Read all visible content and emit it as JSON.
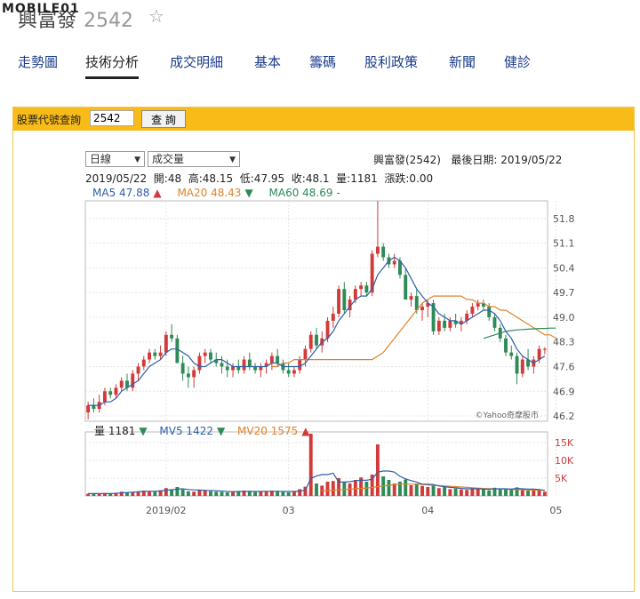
{
  "watermark": "MOBILE01",
  "header": {
    "name": "興富發",
    "code": "2542"
  },
  "tabs": [
    {
      "label": "走勢圖"
    },
    {
      "label": "技術分析"
    },
    {
      "label": "成交明細"
    },
    {
      "label": "基本"
    },
    {
      "label": "籌碼"
    },
    {
      "label": "股利政策"
    },
    {
      "label": "新聞"
    },
    {
      "label": "健診"
    }
  ],
  "query": {
    "label": "股票代號查詢",
    "value": "2542",
    "button": "查 詢"
  },
  "controls": {
    "period": "日線",
    "indicator": "成交量"
  },
  "info": {
    "title": "興富發(2542)",
    "date_label": "最後日期:",
    "date": "2019/05/22"
  },
  "quote": {
    "text": "2019/05/22  開:48  高:48.15  低:47.95  收:48.1  量:1181  漲跌:0.00"
  },
  "ma": [
    {
      "label": "MA5 47.88",
      "arrow": "▲",
      "color": "#2f5fa8",
      "arrow_color": "#d23a3a"
    },
    {
      "label": "MA20 48.43",
      "arrow": "▼",
      "color": "#e0832a",
      "arrow_color": "#2e8b57"
    },
    {
      "label": "MA60 48.69",
      "arrow": "-",
      "color": "#2e8b57",
      "arrow_color": "#2e8b57"
    }
  ],
  "vol_legend": [
    {
      "label": "量 1181",
      "arrow": "▼",
      "color": "#222",
      "arrow_color": "#2e8b57"
    },
    {
      "label": "MV5 1422",
      "arrow": "▼",
      "color": "#2f5fa8",
      "arrow_color": "#2e8b57"
    },
    {
      "label": "MV20 1575",
      "arrow": "▲",
      "color": "#e0832a",
      "arrow_color": "#d23a3a"
    }
  ],
  "copyright": "©Yahoo奇摩股市",
  "chart_data": [
    {
      "type": "candlestick",
      "y_ticks": [
        46.2,
        46.9,
        47.6,
        48.3,
        49.0,
        49.7,
        50.4,
        51.1,
        51.8
      ],
      "ylim": [
        46.05,
        52.3
      ],
      "x_ticks": [
        "2019/02",
        "03",
        "04",
        "05"
      ],
      "x_tick_index": [
        14,
        36,
        61,
        84
      ],
      "up_color": "#d23a3a",
      "down_color": "#2e8b57",
      "ohlc": [
        [
          46.3,
          46.6,
          46.1,
          46.5
        ],
        [
          46.5,
          46.7,
          46.3,
          46.4
        ],
        [
          46.4,
          46.8,
          46.3,
          46.6
        ],
        [
          46.6,
          47.0,
          46.5,
          46.9
        ],
        [
          46.9,
          47.0,
          46.7,
          46.8
        ],
        [
          46.8,
          47.1,
          46.7,
          47.0
        ],
        [
          47.0,
          47.3,
          46.9,
          47.2
        ],
        [
          47.2,
          47.4,
          46.9,
          47.0
        ],
        [
          47.0,
          47.5,
          46.9,
          47.4
        ],
        [
          47.4,
          47.7,
          47.2,
          47.6
        ],
        [
          47.6,
          47.9,
          47.5,
          47.8
        ],
        [
          47.8,
          48.1,
          47.7,
          48.0
        ],
        [
          48.0,
          48.1,
          47.8,
          47.9
        ],
        [
          47.9,
          48.2,
          47.8,
          48.0
        ],
        [
          48.0,
          48.6,
          47.9,
          48.5
        ],
        [
          48.5,
          48.8,
          48.3,
          48.4
        ],
        [
          48.4,
          48.5,
          47.8,
          47.7
        ],
        [
          47.7,
          47.9,
          47.2,
          47.4
        ],
        [
          47.4,
          47.6,
          47.0,
          47.3
        ],
        [
          47.3,
          47.6,
          47.0,
          47.5
        ],
        [
          47.5,
          48.0,
          47.4,
          47.9
        ],
        [
          47.9,
          48.1,
          47.7,
          48.0
        ],
        [
          48.0,
          48.1,
          47.7,
          47.8
        ],
        [
          47.8,
          48.0,
          47.6,
          47.7
        ],
        [
          47.7,
          47.9,
          47.4,
          47.6
        ],
        [
          47.6,
          47.8,
          47.3,
          47.5
        ],
        [
          47.5,
          47.7,
          47.3,
          47.6
        ],
        [
          47.6,
          47.8,
          47.4,
          47.5
        ],
        [
          47.5,
          47.9,
          47.4,
          47.8
        ],
        [
          47.8,
          48.0,
          47.5,
          47.6
        ],
        [
          47.6,
          47.7,
          47.4,
          47.5
        ],
        [
          47.5,
          47.7,
          47.3,
          47.6
        ],
        [
          47.6,
          47.8,
          47.4,
          47.7
        ],
        [
          47.7,
          48.0,
          47.5,
          47.9
        ],
        [
          47.9,
          48.1,
          47.6,
          47.7
        ],
        [
          47.7,
          47.8,
          47.4,
          47.5
        ],
        [
          47.5,
          47.7,
          47.3,
          47.4
        ],
        [
          47.4,
          47.6,
          47.3,
          47.5
        ],
        [
          47.5,
          47.9,
          47.4,
          47.8
        ],
        [
          47.8,
          48.2,
          47.6,
          48.1
        ],
        [
          48.1,
          48.6,
          48.0,
          48.5
        ],
        [
          48.5,
          48.7,
          48.1,
          48.2
        ],
        [
          48.2,
          48.6,
          48.0,
          48.4
        ],
        [
          48.4,
          49.0,
          48.3,
          48.9
        ],
        [
          48.9,
          49.3,
          48.7,
          49.1
        ],
        [
          49.1,
          49.9,
          49.0,
          49.8
        ],
        [
          49.8,
          50.0,
          49.1,
          49.2
        ],
        [
          49.2,
          49.6,
          49.0,
          49.5
        ],
        [
          49.5,
          49.9,
          49.4,
          49.8
        ],
        [
          49.8,
          50.0,
          49.6,
          49.9
        ],
        [
          49.9,
          50.0,
          49.6,
          49.7
        ],
        [
          49.7,
          50.9,
          49.6,
          50.8
        ],
        [
          50.8,
          52.3,
          50.7,
          51.0
        ],
        [
          51.0,
          51.1,
          50.6,
          50.7
        ],
        [
          50.7,
          50.8,
          50.4,
          50.5
        ],
        [
          50.5,
          50.8,
          50.4,
          50.6
        ],
        [
          50.6,
          50.7,
          50.1,
          50.2
        ],
        [
          50.2,
          50.4,
          49.8,
          49.5
        ],
        [
          49.5,
          49.7,
          49.3,
          49.6
        ],
        [
          49.6,
          49.8,
          49.1,
          49.2
        ],
        [
          49.2,
          49.4,
          48.9,
          49.3
        ],
        [
          49.3,
          49.5,
          49.0,
          49.4
        ],
        [
          49.4,
          49.5,
          48.5,
          48.6
        ],
        [
          48.6,
          49.0,
          48.5,
          48.9
        ],
        [
          48.9,
          49.1,
          48.6,
          48.7
        ],
        [
          48.7,
          49.0,
          48.6,
          48.9
        ],
        [
          48.9,
          49.1,
          48.7,
          48.8
        ],
        [
          48.8,
          49.0,
          48.6,
          48.9
        ],
        [
          48.9,
          49.2,
          48.8,
          49.1
        ],
        [
          49.1,
          49.4,
          49.0,
          49.3
        ],
        [
          49.3,
          49.5,
          49.2,
          49.4
        ],
        [
          49.4,
          49.5,
          49.2,
          49.3
        ],
        [
          49.3,
          49.4,
          48.9,
          49.0
        ],
        [
          49.0,
          49.1,
          48.6,
          48.7
        ],
        [
          48.7,
          48.8,
          48.3,
          48.4
        ],
        [
          48.4,
          48.5,
          47.9,
          48.0
        ],
        [
          48.0,
          48.2,
          47.8,
          47.9
        ],
        [
          47.9,
          48.0,
          47.1,
          47.4
        ],
        [
          47.4,
          47.9,
          47.3,
          47.8
        ],
        [
          47.8,
          48.1,
          47.5,
          47.6
        ],
        [
          47.6,
          47.9,
          47.4,
          47.8
        ],
        [
          47.8,
          48.2,
          47.7,
          48.1
        ],
        [
          48.1,
          48.15,
          47.95,
          48.1
        ]
      ],
      "ma5": [
        46.5,
        46.5,
        46.5,
        46.6,
        46.6,
        46.7,
        46.9,
        47.0,
        47.1,
        47.2,
        47.4,
        47.6,
        47.7,
        47.8,
        48.0,
        48.1,
        48.1,
        48.0,
        47.9,
        47.7,
        47.6,
        47.6,
        47.7,
        47.8,
        47.8,
        47.7,
        47.6,
        47.6,
        47.6,
        47.6,
        47.6,
        47.6,
        47.6,
        47.7,
        47.7,
        47.6,
        47.6,
        47.6,
        47.6,
        47.7,
        47.9,
        48.1,
        48.3,
        48.4,
        48.6,
        48.9,
        49.1,
        49.3,
        49.5,
        49.6,
        49.6,
        49.8,
        50.2,
        50.4,
        50.6,
        50.7,
        50.6,
        50.4,
        50.1,
        49.8,
        49.6,
        49.4,
        49.3,
        49.1,
        49.0,
        48.9,
        48.9,
        48.8,
        48.9,
        49.0,
        49.1,
        49.2,
        49.2,
        49.1,
        48.9,
        48.6,
        48.4,
        48.1,
        47.9,
        47.8,
        47.7,
        47.8,
        47.9
      ],
      "ma5_from": 0,
      "ma20": [
        47.6,
        47.6,
        47.7,
        47.7,
        47.8,
        47.8,
        47.8,
        47.8,
        47.8,
        47.8,
        47.8,
        47.8,
        47.8,
        47.8,
        47.8,
        47.8,
        47.8,
        47.8,
        47.8,
        47.9,
        48.0,
        48.2,
        48.4,
        48.6,
        48.8,
        49.0,
        49.2,
        49.4,
        49.5,
        49.6,
        49.6,
        49.6,
        49.6,
        49.6,
        49.6,
        49.5,
        49.5,
        49.4,
        49.4,
        49.3,
        49.3,
        49.2,
        49.2,
        49.1,
        49.0,
        48.9,
        48.8,
        48.7,
        48.6,
        48.5,
        48.5,
        48.4
      ],
      "ma20_from": 33,
      "ma60": [
        48.4,
        48.45,
        48.5,
        48.55,
        48.6,
        48.62,
        48.64,
        48.65,
        48.66,
        48.67,
        48.68,
        48.68,
        48.69,
        48.69
      ],
      "ma60_from": 71
    },
    {
      "type": "bar",
      "y_ticks": [
        5000,
        10000,
        15000
      ],
      "y_tick_labels": [
        "5K",
        "10K",
        "15K"
      ],
      "ylim": [
        0,
        18000
      ],
      "volume": [
        600,
        500,
        700,
        800,
        600,
        900,
        1200,
        1000,
        1100,
        1300,
        1500,
        1400,
        1200,
        1600,
        2200,
        1900,
        2500,
        1800,
        1300,
        1200,
        1600,
        1700,
        1300,
        1200,
        1100,
        1000,
        1300,
        1200,
        1500,
        1400,
        1100,
        1200,
        1300,
        1500,
        1400,
        1100,
        1000,
        1300,
        1900,
        2600,
        17500,
        3500,
        2900,
        4000,
        4200,
        5000,
        3800,
        3500,
        4500,
        5200,
        4000,
        6000,
        14500,
        5500,
        4500,
        3500,
        4000,
        4600,
        3000,
        3500,
        2800,
        2500,
        3000,
        2200,
        2600,
        1900,
        2100,
        1800,
        1700,
        2300,
        2000,
        1900,
        1600,
        2300,
        2100,
        2000,
        1800,
        2400,
        1800,
        1500,
        1700,
        1600,
        1181
      ],
      "mv5": [
        650,
        650,
        650,
        650,
        650,
        700,
        850,
        950,
        1050,
        1150,
        1300,
        1300,
        1300,
        1400,
        1600,
        1700,
        1900,
        2000,
        1800,
        1700,
        1650,
        1550,
        1500,
        1450,
        1350,
        1250,
        1200,
        1250,
        1250,
        1300,
        1250,
        1250,
        1300,
        1300,
        1300,
        1250,
        1250,
        1250,
        1350,
        1600,
        4900,
        5600,
        6000,
        6000,
        6400,
        3900,
        3900,
        4000,
        4300,
        4400,
        4400,
        4700,
        6700,
        7000,
        7000,
        6700,
        5500,
        4800,
        4300,
        3900,
        3300,
        3300,
        3200,
        2800,
        2600,
        2400,
        2300,
        2100,
        2000,
        2000,
        2000,
        1900,
        1900,
        2000,
        2000,
        2000,
        1900,
        2100,
        2000,
        1900,
        1900,
        1800,
        1550
      ],
      "mv20": [
        1400,
        1500,
        1600,
        1700,
        1800,
        1900,
        2000,
        2100,
        2200,
        2400,
        2600,
        2800,
        3000,
        3200,
        3300,
        3300,
        3300,
        3300,
        3200,
        3100,
        3000,
        2900,
        2800,
        2700,
        2600,
        2500,
        2400,
        2300,
        2200,
        2100,
        2050,
        2000,
        1950,
        1900,
        1850,
        1800,
        1750,
        1700,
        1650,
        1600,
        1575
      ],
      "mv20_from": 42
    }
  ]
}
